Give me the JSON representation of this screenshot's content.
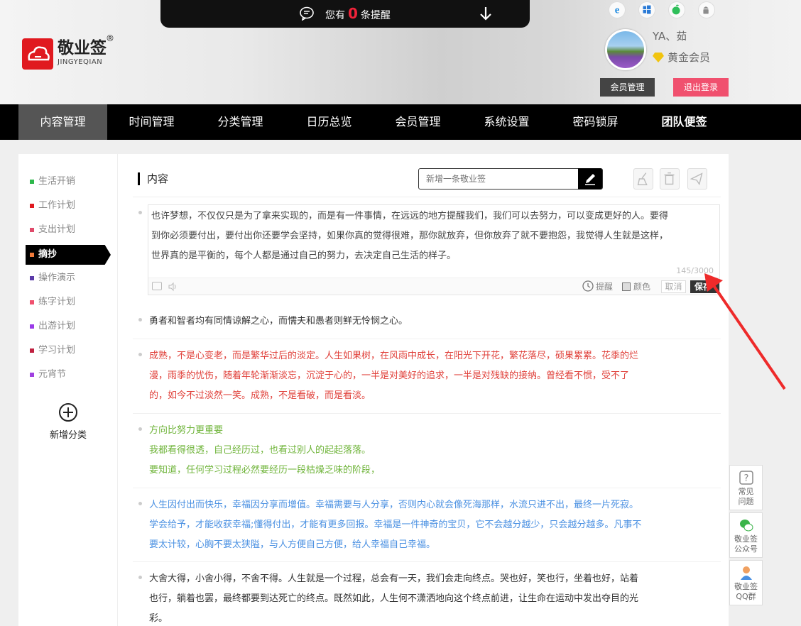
{
  "notice": {
    "prefix": "您有",
    "count": "0",
    "suffix": "条提醒"
  },
  "logo": {
    "name": "敬业签",
    "reg": "®",
    "en": "JINGYEQIAN"
  },
  "platform_icons": [
    "ie-icon",
    "windows-icon",
    "apple-icon",
    "android-icon"
  ],
  "user": {
    "name": "YA、茹",
    "level": "黄金会员",
    "member_btn": "会员管理",
    "logout_btn": "退出登录"
  },
  "nav": [
    "内容管理",
    "时间管理",
    "分类管理",
    "日历总览",
    "会员管理",
    "系统设置",
    "密码锁屏",
    "团队便签"
  ],
  "categories": [
    {
      "label": "生活开销",
      "color": "#2db84b"
    },
    {
      "label": "工作计划",
      "color": "#e0191f"
    },
    {
      "label": "支出计划",
      "color": "#e04a6a"
    },
    {
      "label": "摘抄",
      "color": "#f07a3a"
    },
    {
      "label": "操作演示",
      "color": "#5a3aa8"
    },
    {
      "label": "练字计划",
      "color": "#f0506e"
    },
    {
      "label": "出游计划",
      "color": "#9a3ae8"
    },
    {
      "label": "学习计划",
      "color": "#c02040"
    },
    {
      "label": "元宵节",
      "color": "#a040e0"
    }
  ],
  "add_category": "新增分类",
  "content": {
    "title": "内容",
    "new_placeholder": "新增一条敬业签"
  },
  "editor": {
    "lines": [
      "也许梦想，不仅仅只是为了拿来实现的，而是有一件事情，在远远的地方提醒我们，我们可以去努力，可以变成更好的人。要得",
      "到你必须要付出，要付出你还要学会坚持，如果你真的觉得很难，那你就放弃，但你放弃了就不要抱怨，我觉得人生就是这样，",
      "世界真的是平衡的，每个人都是通过自己的努力，去决定自己生活的样子。"
    ],
    "count": "145/3000",
    "remind": "提醒",
    "color": "颜色",
    "cancel": "取消",
    "save": "保存"
  },
  "notes": [
    {
      "color": "#333333",
      "lines": [
        "勇者和智者均有同情谅解之心，而懦夫和愚者则鲜无怜悯之心。"
      ]
    },
    {
      "color": "#e0403a",
      "lines": [
        "成熟，不是心变老，而是繁华过后的淡定。人生如果树，在风雨中成长，在阳光下开花，繁花落尽，硕果累累。花季的烂",
        "漫，雨季的忧伤，随着年轮渐渐淡忘，沉淀于心的，一半是对美好的追求，一半是对残缺的接纳。曾经看不惯，受不了",
        "的，如今不过淡然一笑。成熟，不是看破，而是看淡。"
      ]
    },
    {
      "color": "#6fb43a",
      "lines": [
        "方向比努力更重要",
        "我都看得很透，自己经历过，也看过别人的起起落落。",
        "要知道，任何学习过程必然要经历一段枯燥乏味的阶段，"
      ]
    },
    {
      "color": "#4a90e2",
      "lines": [
        "人生因付出而快乐，幸福因分享而增值。幸福需要与人分享，否则内心就会像死海那样，水流只进不出，最终一片死寂。",
        "学会给予，才能收获幸福;懂得付出，才能有更多回报。幸福是一件神奇的宝贝，它不会越分越少，只会越分越多。凡事不",
        "要太计较，心胸不要太狭隘，与人方便自己方便，给人幸福自己幸福。"
      ]
    },
    {
      "color": "#333333",
      "lines": [
        "大舍大得，小舍小得，不舍不得。人生就是一个过程，总会有一天，我们会走向终点。哭也好，笑也行，坐着也好，站着",
        "也行，躺着也罢，最终都要到达死亡的终点。既然如此，人生何不潇洒地向这个终点前进，让生命在运动中发出夺目的光",
        "彩。"
      ]
    }
  ],
  "float_buttons": [
    {
      "label1": "常见",
      "label2": "问题"
    },
    {
      "label1": "敬业签",
      "label2": "公众号"
    },
    {
      "label1": "敬业签",
      "label2": "QQ群"
    }
  ]
}
